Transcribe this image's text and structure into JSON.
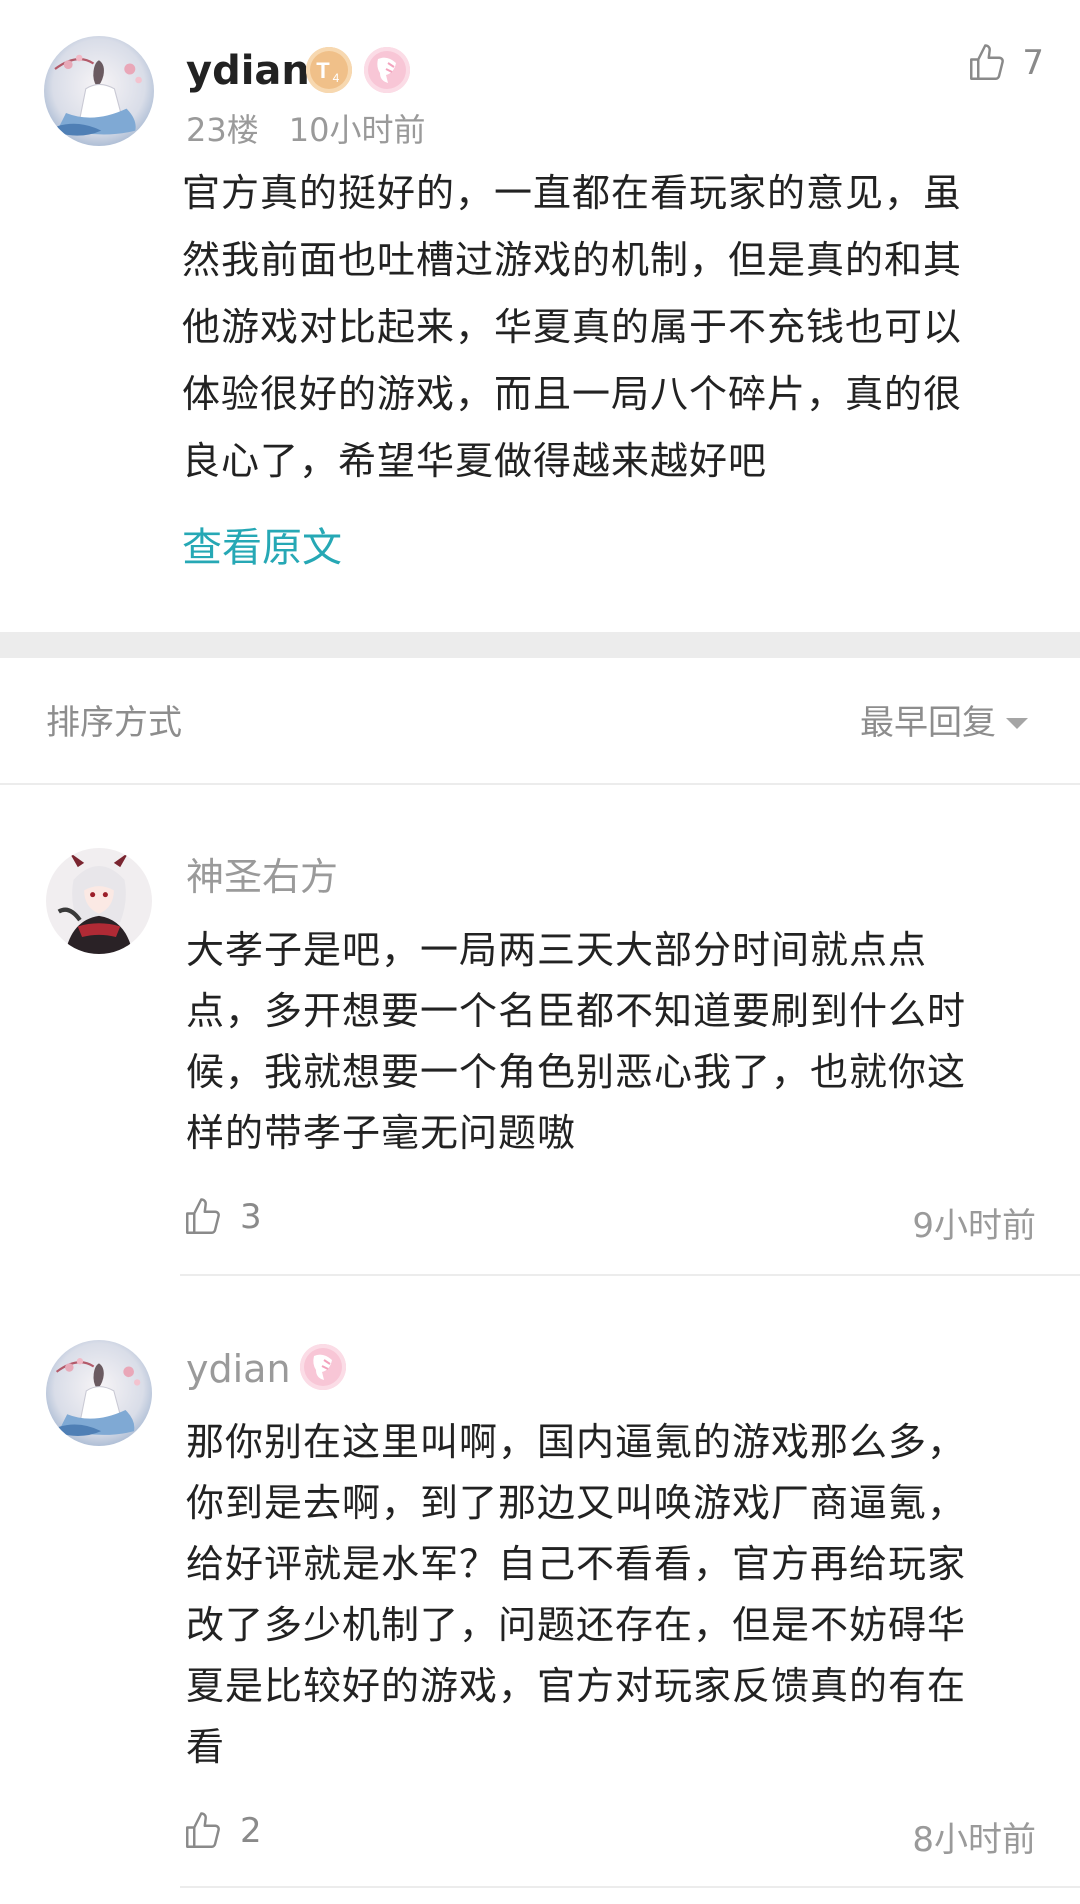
{
  "post": {
    "username": "ydian",
    "floor": "23楼",
    "time": "10小时前",
    "like_count": "7",
    "text": "官方真的挺好的，一直都在看玩家的意见，虽\n然我前面也吐槽过游戏的机制，但是真的和其\n他游戏对比起来，华夏真的属于不充钱也可以\n体验很好的游戏，而且一局八个碎片，真的很\n良心了，希望华夏做得越来越好吧",
    "view_original": "查看原文",
    "badges": [
      {
        "icon": "level-badge-icon",
        "label": "T",
        "sub": "4",
        "color": "#f3c58f"
      },
      {
        "icon": "fan-badge-icon",
        "color": "#f6b9cf"
      }
    ]
  },
  "sort": {
    "label": "排序方式",
    "selected": "最早回复"
  },
  "replies": [
    {
      "username": "神圣右方",
      "text": "大孝子是吧，一局两三天大部分时间就点点\n点，多开想要一个名臣都不知道要刷到什么时\n候，我就想要一个角色别恶心我了，也就你这\n样的带孝子毫无问题嗷",
      "like_count": "3",
      "time": "9小时前"
    },
    {
      "username": "ydian",
      "text": "那你别在这里叫啊，国内逼氪的游戏那么多，\n你到是去啊，到了那边又叫唤游戏厂商逼氪，\n给好评就是水军？自己不看看，官方再给玩家\n改了多少机制了，问题还存在，但是不妨碍华\n夏是比较好的游戏，官方对玩家反馈真的有在\n看",
      "like_count": "2",
      "time": "8小时前"
    }
  ],
  "colors": {
    "accent": "#26a8b5",
    "meta": "#9a9a9a",
    "divider": "#ececec",
    "band": "#ececec"
  }
}
